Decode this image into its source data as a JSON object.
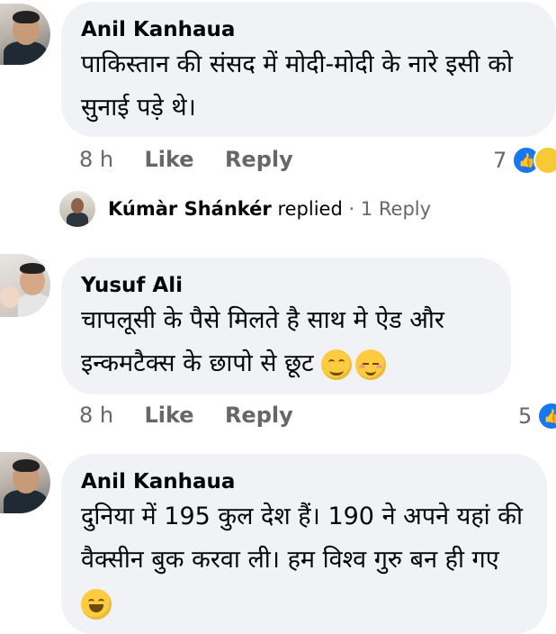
{
  "comments": [
    {
      "author": "Anil Kanhaua",
      "text": "पाकिस्तान की संसद में मोदी-मोदी के नारे इसी को सुनाई पड़े थे।",
      "time": "8 h",
      "like": "Like",
      "reply": "Reply",
      "reaction_count": "7",
      "reactions": [
        "like-icon",
        "haha-icon"
      ]
    },
    {
      "author": "Yusuf Ali",
      "text": "चापलूसी के पैसे मिलते है साथ मे ऐड और इन्कमटैक्स के छापो से छूट",
      "emojis": [
        "smiling-face-icon",
        "relieved-face-icon"
      ],
      "time": "8 h",
      "like": "Like",
      "reply": "Reply",
      "reaction_count": "5",
      "reactions": [
        "like-icon"
      ]
    },
    {
      "author": "Anil Kanhaua",
      "text": "दुनिया में 195 कुल देश हैं। 190 ने अपने यहां की वैक्सीन बुक करवा ली। हम विश्व गुरु बन ही गए",
      "emojis": [
        "laughing-tears-icon"
      ]
    }
  ],
  "reply_preview": {
    "name": "Kúmàr Shánkér",
    "verb": "replied",
    "separator": "·",
    "count": "1 Reply"
  }
}
